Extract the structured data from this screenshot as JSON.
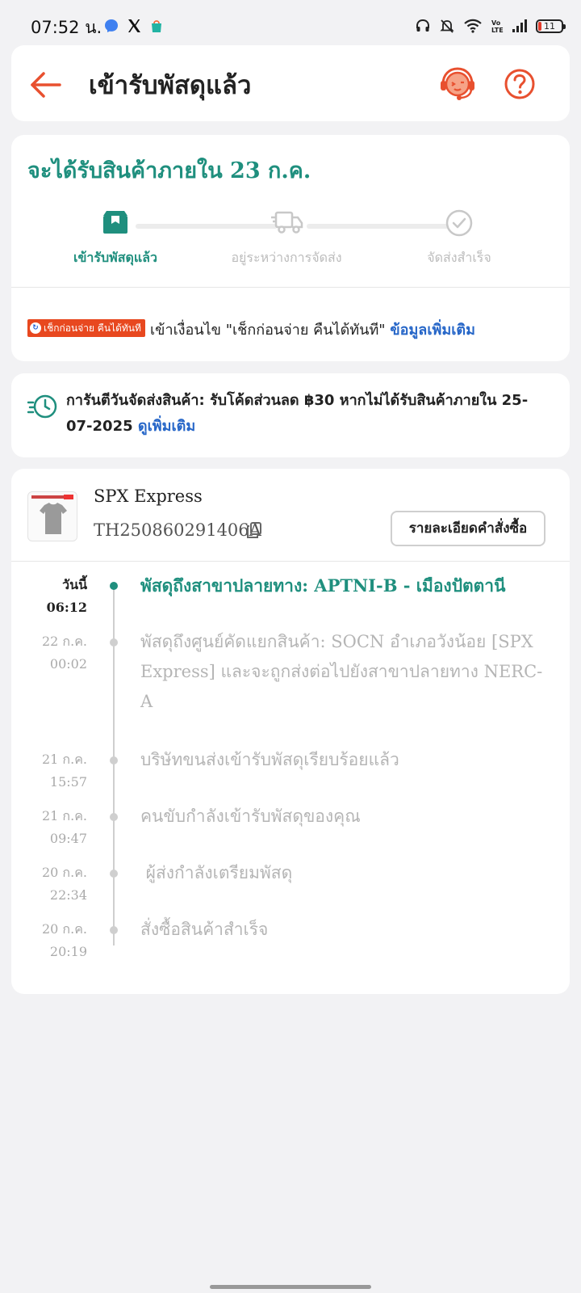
{
  "status_bar": {
    "time": "07:52 น.",
    "battery": "11",
    "icons": [
      "messenger-icon",
      "x-icon",
      "shopee-icon",
      "headphones-icon",
      "mute-icon",
      "wifi-icon",
      "volte-icon",
      "signal-icon",
      "battery-icon"
    ]
  },
  "header": {
    "title": "เข้ารับพัสดุแล้ว",
    "accent_color": "#e8502f"
  },
  "progress": {
    "eta": "จะได้รับสินค้าภายใน 23 ก.ค.",
    "steps": [
      {
        "label": "เข้ารับพัสดุแล้ว",
        "icon": "parcel-icon",
        "active": true
      },
      {
        "label": "อยู่ระหว่างการจัดส่ง",
        "icon": "truck-icon",
        "active": false
      },
      {
        "label": "จัดส่งสำเร็จ",
        "icon": "check-circle-icon",
        "active": false
      }
    ],
    "promo_badge": "เช็กก่อนจ่าย คืนได้ทันที",
    "promo_text": "เข้าเงื่อนไข \"เช็กก่อนจ่าย คืนได้ทันที\"",
    "promo_link": "ข้อมูลเพิ่มเติม",
    "accent_color": "#1f8f7e"
  },
  "guarantee": {
    "text": "การันตีวันจัดส่งสินค้า: รับโค้ดส่วนลด ฿30 หากไม่ได้รับสินค้าภายใน 25-07-2025",
    "link": "ดูเพิ่มเติม",
    "icon": "fast-clock-icon"
  },
  "tracking": {
    "carrier": "SPX Express",
    "tracking_number": "TH250860291406A",
    "order_details_button": "รายละเอียดคำสั่งซื้อ",
    "events": [
      {
        "date": "วันนี้",
        "time": "06:12",
        "text": "พัสดุถึงสาขาปลายทาง: APTNI-B - เมืองปัตตานี",
        "active": true
      },
      {
        "date": "22 ก.ค.",
        "time": "00:02",
        "text": "พัสดุถึงศูนย์คัดแยกสินค้า: SOCN อำเภอวังน้อย [SPX Express] และจะถูกส่งต่อไปยังสาขาปลายทาง NERC-A",
        "active": false
      },
      {
        "date": "21 ก.ค.",
        "time": "15:57",
        "text": "บริษัทขนส่งเข้ารับพัสดุเรียบร้อยแล้ว",
        "active": false
      },
      {
        "date": "21 ก.ค.",
        "time": "09:47",
        "text": "คนขับกำลังเข้ารับพัสดุของคุณ",
        "active": false
      },
      {
        "date": "20 ก.ค.",
        "time": "22:34",
        "text": " ผู้ส่งกำลังเตรียมพัสดุ",
        "active": false
      },
      {
        "date": "20 ก.ค.",
        "time": "20:19",
        "text": "สั่งซื้อสินค้าสำเร็จ",
        "active": false
      }
    ]
  }
}
